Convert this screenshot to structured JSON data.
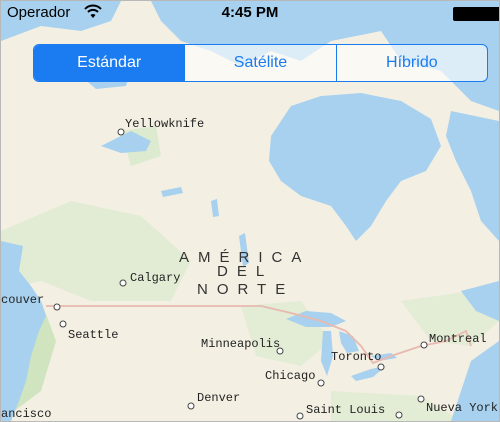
{
  "status_bar": {
    "carrier": "Operador",
    "time": "4:45 PM"
  },
  "map_type_control": {
    "segments": [
      {
        "label": "Estándar",
        "selected": true
      },
      {
        "label": "Satélite",
        "selected": false
      },
      {
        "label": "Híbrido",
        "selected": false
      }
    ]
  },
  "map": {
    "continent_label": [
      "AMÉRICA",
      "DEL",
      "NORTE"
    ],
    "cities": {
      "yellowknife": "Yellowknife",
      "calgary": "Calgary",
      "vancouver": "couver",
      "seattle": "Seattle",
      "minneapolis": "Minneapolis",
      "toronto": "Toronto",
      "montreal": "Montreal",
      "chicago": "Chicago",
      "denver": "Denver",
      "saint_louis": "Saint Louis",
      "nueva_york": "Nueva York",
      "san_francisco": "ancisco"
    }
  },
  "colors": {
    "accent": "#1a7cf0",
    "water": "#a7d1ee",
    "land": "#f4efe3",
    "vegetation": "#dcebcf",
    "border_line": "#e8b9b0"
  }
}
